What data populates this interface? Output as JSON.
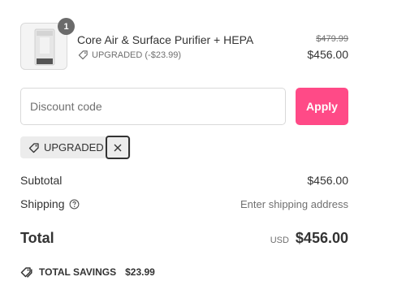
{
  "line_item": {
    "quantity": "1",
    "title": "Core Air & Surface Purifier + HEPA",
    "discount_label": "UPGRADED (-$23.99)",
    "original_price": "$479.99",
    "price": "$456.00",
    "thumbnail_icon": "air-purifier"
  },
  "discount": {
    "placeholder": "Discount code",
    "apply_label": "Apply",
    "applied_code": "UPGRADED"
  },
  "summary": {
    "subtotal_label": "Subtotal",
    "subtotal_value": "$456.00",
    "shipping_label": "Shipping",
    "shipping_value": "Enter shipping address",
    "total_label": "Total",
    "currency": "USD",
    "total_value": "$456.00"
  },
  "savings": {
    "label": "TOTAL SAVINGS",
    "amount": "$23.99"
  },
  "colors": {
    "accent": "#ff4a87",
    "text": "#333333",
    "muted": "#707070",
    "border": "#d9d9d9"
  }
}
